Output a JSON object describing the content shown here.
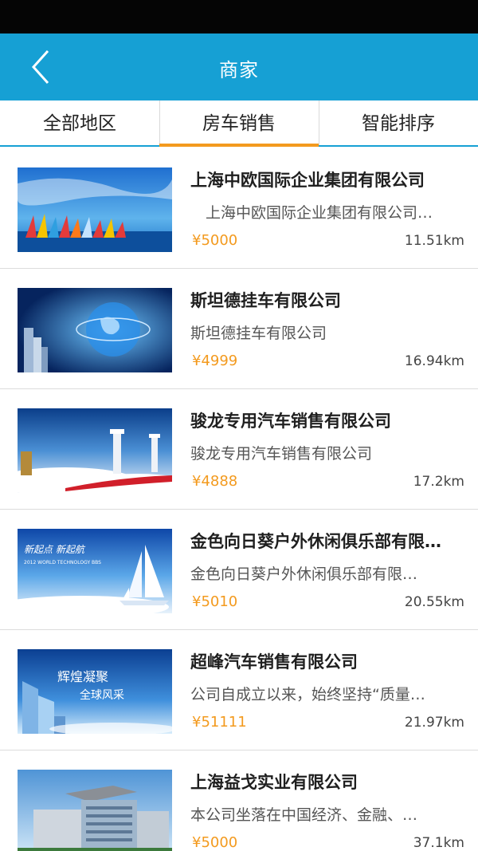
{
  "header": {
    "title": "商家"
  },
  "tabs": [
    {
      "label": "全部地区"
    },
    {
      "label": "房车销售"
    },
    {
      "label": "智能排序"
    }
  ],
  "active_tab": "房车销售",
  "colors": {
    "accent": "#16a0d4",
    "highlight": "#f39a1e"
  },
  "merchants": [
    {
      "name": "上海中欧国际企业集团有限公司",
      "description": "　上海中欧国际企业集团有限公司…",
      "price": "¥5000",
      "distance": "11.51km",
      "image": "sailboats-banner"
    },
    {
      "name": "斯坦德挂车有限公司",
      "description": "斯坦德挂车有限公司",
      "price": "¥4999",
      "distance": "16.94km",
      "image": "globe-city-banner"
    },
    {
      "name": "骏龙专用汽车销售有限公司",
      "description": "骏龙专用汽车销售有限公司",
      "price": "¥4888",
      "distance": "17.2km",
      "image": "columns-clouds-banner"
    },
    {
      "name": "金色向日葵户外休闲俱乐部有限…",
      "description": "金色向日葵户外休闲俱乐部有限…",
      "price": "¥5010",
      "distance": "20.55km",
      "image": "world-technology-sails-banner"
    },
    {
      "name": "超峰汽车销售有限公司",
      "description": "公司自成立以来，始终坚持“质量…",
      "price": "¥51111",
      "distance": "21.97km",
      "image": "skyscraper-banner"
    },
    {
      "name": "上海益戈实业有限公司",
      "description": "本公司坐落在中国经济、金融、…",
      "price": "¥5000",
      "distance": "37.1km",
      "image": "office-building-banner"
    }
  ],
  "banner_text": {
    "banner4_line1": "新起点  新起航",
    "banner4_line2": "2012 WORLD TECHNOLOGY BBS",
    "banner5_line1": "辉煌凝聚",
    "banner5_line2": "全球风采"
  }
}
